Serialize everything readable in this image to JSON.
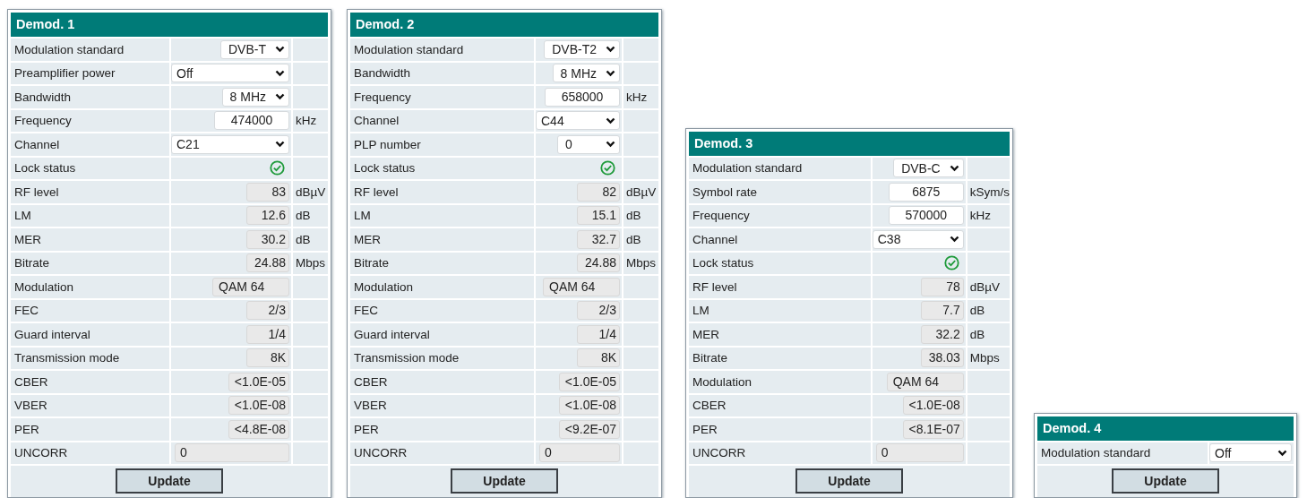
{
  "panels": [
    {
      "title": "Demod. 1",
      "button": "Update",
      "rows": [
        {
          "label": "Modulation standard",
          "kind": "select",
          "value": "DVB-T"
        },
        {
          "label": "Preamplifier power",
          "kind": "select",
          "value": "Off"
        },
        {
          "label": "Bandwidth",
          "kind": "select",
          "value": "8 MHz"
        },
        {
          "label": "Frequency",
          "kind": "input",
          "value": "474000",
          "unit": "kHz"
        },
        {
          "label": "Channel",
          "kind": "select",
          "value": "C21"
        },
        {
          "label": "Lock status",
          "kind": "status",
          "locked": true
        },
        {
          "label": "RF level",
          "kind": "readout",
          "value": "83",
          "unit": "dBµV"
        },
        {
          "label": "LM",
          "kind": "readout",
          "value": "12.6",
          "unit": "dB"
        },
        {
          "label": "MER",
          "kind": "readout",
          "value": "30.2",
          "unit": "dB"
        },
        {
          "label": "Bitrate",
          "kind": "readout",
          "value": "24.88",
          "unit": "Mbps"
        },
        {
          "label": "Modulation",
          "kind": "readout",
          "value": "QAM 64"
        },
        {
          "label": "FEC",
          "kind": "readout",
          "value": "2/3"
        },
        {
          "label": "Guard interval",
          "kind": "readout",
          "value": "1/4"
        },
        {
          "label": "Transmission mode",
          "kind": "readout",
          "value": "8K"
        },
        {
          "label": "CBER",
          "kind": "readout",
          "value": "<1.0E-05"
        },
        {
          "label": "VBER",
          "kind": "readout",
          "value": "<1.0E-08"
        },
        {
          "label": "PER",
          "kind": "readout",
          "value": "<4.8E-08"
        },
        {
          "label": "UNCORR",
          "kind": "counter",
          "value": "0"
        }
      ]
    },
    {
      "title": "Demod. 2",
      "button": "Update",
      "rows": [
        {
          "label": "Modulation standard",
          "kind": "select",
          "value": "DVB-T2"
        },
        {
          "label": "Bandwidth",
          "kind": "select",
          "value": "8 MHz"
        },
        {
          "label": "Frequency",
          "kind": "input",
          "value": "658000",
          "unit": "kHz"
        },
        {
          "label": "Channel",
          "kind": "select",
          "value": "C44"
        },
        {
          "label": "PLP number",
          "kind": "select",
          "value": "0"
        },
        {
          "label": "Lock status",
          "kind": "status",
          "locked": true
        },
        {
          "label": "RF level",
          "kind": "readout",
          "value": "82",
          "unit": "dBµV"
        },
        {
          "label": "LM",
          "kind": "readout",
          "value": "15.1",
          "unit": "dB"
        },
        {
          "label": "MER",
          "kind": "readout",
          "value": "32.7",
          "unit": "dB"
        },
        {
          "label": "Bitrate",
          "kind": "readout",
          "value": "24.88",
          "unit": "Mbps"
        },
        {
          "label": "Modulation",
          "kind": "readout",
          "value": "QAM 64"
        },
        {
          "label": "FEC",
          "kind": "readout",
          "value": "2/3"
        },
        {
          "label": "Guard interval",
          "kind": "readout",
          "value": "1/4"
        },
        {
          "label": "Transmission mode",
          "kind": "readout",
          "value": "8K"
        },
        {
          "label": "CBER",
          "kind": "readout",
          "value": "<1.0E-05"
        },
        {
          "label": "VBER",
          "kind": "readout",
          "value": "<1.0E-08"
        },
        {
          "label": "PER",
          "kind": "readout",
          "value": "<9.2E-07"
        },
        {
          "label": "UNCORR",
          "kind": "counter",
          "value": "0"
        }
      ]
    },
    {
      "title": "Demod. 3",
      "button": "Update",
      "rows": [
        {
          "label": "Modulation standard",
          "kind": "select",
          "value": "DVB-C"
        },
        {
          "label": "Symbol rate",
          "kind": "input",
          "value": "6875",
          "unit": "kSym/s"
        },
        {
          "label": "Frequency",
          "kind": "input",
          "value": "570000",
          "unit": "kHz"
        },
        {
          "label": "Channel",
          "kind": "select",
          "value": "C38"
        },
        {
          "label": "Lock status",
          "kind": "status",
          "locked": true
        },
        {
          "label": "RF level",
          "kind": "readout",
          "value": "78",
          "unit": "dBµV"
        },
        {
          "label": "LM",
          "kind": "readout",
          "value": "7.7",
          "unit": "dB"
        },
        {
          "label": "MER",
          "kind": "readout",
          "value": "32.2",
          "unit": "dB"
        },
        {
          "label": "Bitrate",
          "kind": "readout",
          "value": "38.03",
          "unit": "Mbps"
        },
        {
          "label": "Modulation",
          "kind": "readout",
          "value": "QAM 64"
        },
        {
          "label": "CBER",
          "kind": "readout",
          "value": "<1.0E-08"
        },
        {
          "label": "PER",
          "kind": "readout",
          "value": "<8.1E-07"
        },
        {
          "label": "UNCORR",
          "kind": "counter",
          "value": "0"
        }
      ]
    },
    {
      "title": "Demod. 4",
      "button": "Update",
      "rows": [
        {
          "label": "Modulation standard",
          "kind": "select",
          "value": "Off"
        }
      ]
    }
  ]
}
